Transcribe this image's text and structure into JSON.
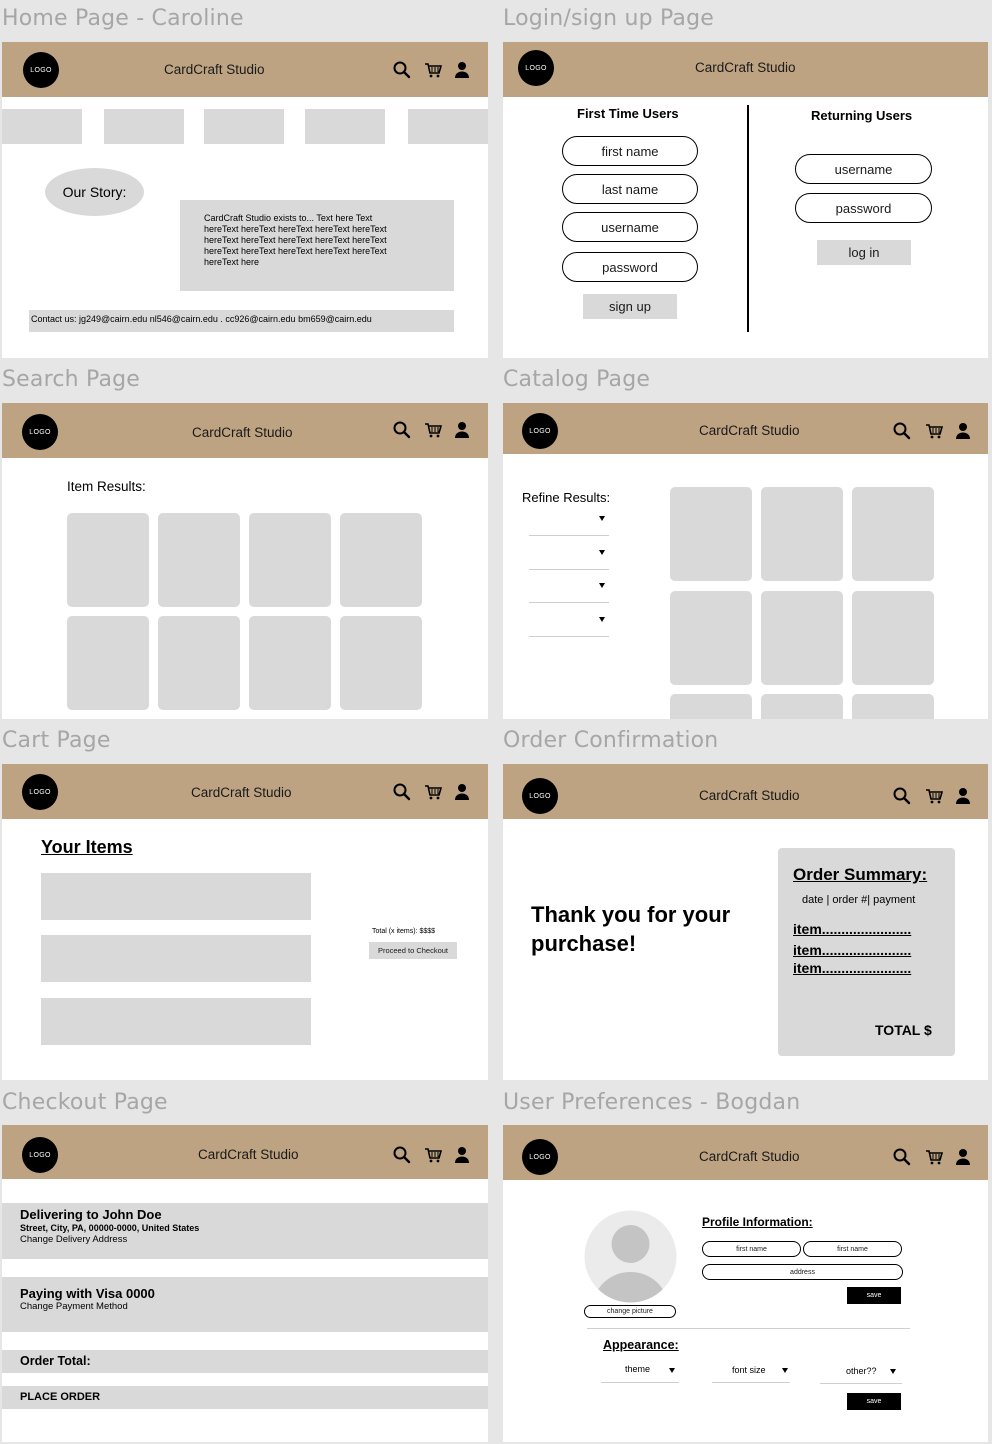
{
  "frames": {
    "home": "Home Page - Caroline",
    "login": "Login/sign up Page",
    "search": "Search Page",
    "catalog": "Catalog Page",
    "cart": "Cart Page",
    "order": "Order Confirmation",
    "checkout": "Checkout Page",
    "prefs": "User Preferences - Bogdan"
  },
  "common": {
    "logo": "LOGO",
    "brand": "CardCraft Studio",
    "icons": [
      "search-icon",
      "cart-icon",
      "user-icon"
    ]
  },
  "home": {
    "story_label": "Our Story:",
    "story_lines": [
      "CardCraft Studio exists to... Text here Text",
      "hereText hereText hereText hereText hereText",
      "hereText hereText hereText hereText hereText",
      "hereText hereText hereText hereText hereText",
      "hereText here"
    ],
    "contact": "Contact us:  jg249@cairn.edu  nl546@cairn.edu . cc926@cairn.edu   bm659@cairn.edu"
  },
  "login": {
    "first_title": "First Time Users",
    "returning_title": "Returning Users",
    "first_name": "first name",
    "last_name": "last name",
    "username": "username",
    "password": "password",
    "sign_up": "sign up",
    "r_username": "username",
    "r_password": "password",
    "log_in": "log in"
  },
  "search": {
    "results_label": "Item Results:"
  },
  "catalog": {
    "refine_label": "Refine Results:"
  },
  "cart": {
    "title": "Your Items",
    "total": "Total (x items): $$$$",
    "checkout": "Proceed to Checkout"
  },
  "order": {
    "thanks_1": "Thank you for your",
    "thanks_2": "purchase!",
    "summary_title": "Order Summary:",
    "summary_meta": "date | order #| payment",
    "items": [
      "item.......................",
      "item.......................",
      "item......................."
    ],
    "total": "TOTAL $"
  },
  "checkout": {
    "deliver_title": "Delivering to John Doe",
    "deliver_address": "Street, City, PA, 00000-0000, United States",
    "deliver_change": "Change Delivery Address",
    "pay_title": "Paying with Visa 0000",
    "pay_change": "Change Payment Method",
    "order_total": "Order Total:",
    "place_order": "PLACE ORDER"
  },
  "prefs": {
    "change_picture": "change picture",
    "profile_title": "Profile Information:",
    "first_name_1": "first name",
    "first_name_2": "first name",
    "address": "address",
    "save_1": "save",
    "appearance_title": "Appearance:",
    "theme": "theme",
    "font_size": "font size",
    "other": "other??",
    "save_2": "save"
  }
}
